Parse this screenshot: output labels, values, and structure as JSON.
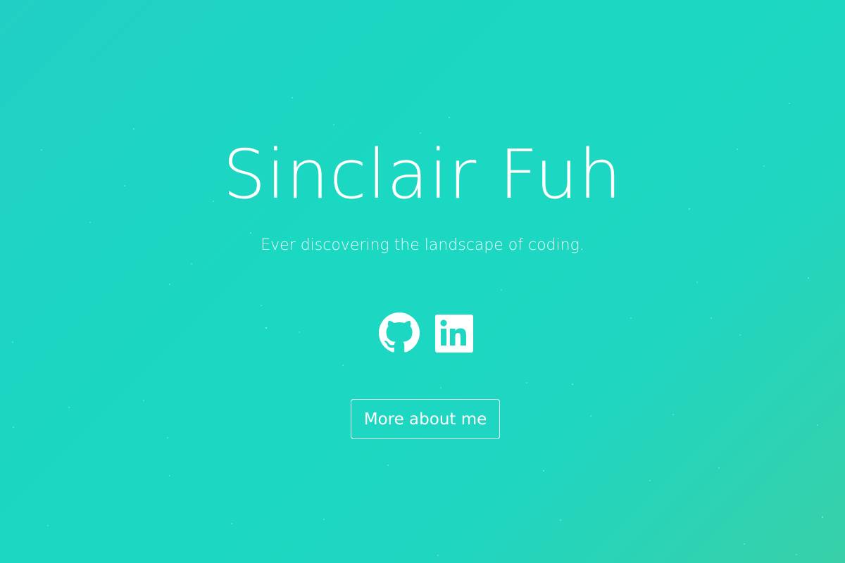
{
  "hero": {
    "title": "Sinclair Fuh",
    "subtitle": "Ever discovering the landscape of coding."
  },
  "social": {
    "links": [
      {
        "icon": "github-icon"
      },
      {
        "icon": "linkedin-icon"
      }
    ]
  },
  "cta": {
    "label": "More about me"
  },
  "colors": {
    "background_start": "#22cfc4",
    "background_end": "#38d0a8",
    "foreground": "#ffffff"
  }
}
